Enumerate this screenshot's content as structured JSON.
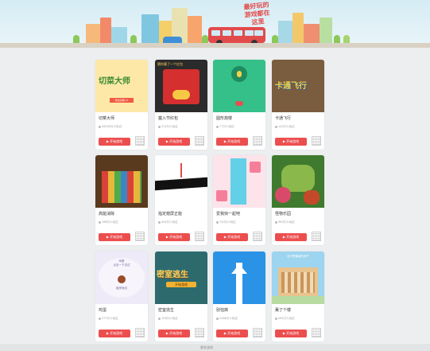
{
  "banner": {
    "slogan": "最好玩的\n游戏都在\n这里"
  },
  "cards": [
    {
      "title": "切菜大师",
      "plays": "28200万人玩过",
      "start": "开始游戏",
      "thumb_text": "切菜大师",
      "thumb_sub": "攻击次数+5"
    },
    {
      "title": "塞入节红包",
      "plays": "312万人玩过",
      "start": "开始游戏",
      "thumb_text": "猜你塞了一个红包"
    },
    {
      "title": "圆形炮楼",
      "plays": "77万人玩过",
      "start": "开始游戏",
      "thumb_text": ""
    },
    {
      "title": "卡通飞行",
      "plays": "142万人玩过",
      "start": "开始游戏",
      "thumb_text": "卡通飞行"
    },
    {
      "title": "高能消除",
      "plays": "168万人玩过",
      "start": "开始游戏",
      "thumb_text": ""
    },
    {
      "title": "指定窥屏正能",
      "plays": "404万人玩过",
      "start": "开始游戏",
      "thumb_text": ""
    },
    {
      "title": "爱我快一起吧",
      "plays": "743万人玩过",
      "start": "开始游戏",
      "thumb_text": ""
    },
    {
      "title": "怪物乐园",
      "plays": "363万人玩过",
      "start": "开始游戏",
      "thumb_text": ""
    },
    {
      "title": "鸡蛋",
      "plays": "377万人玩过",
      "start": "开始游戏",
      "thumb_text": "鸡蛋\n点击一下试试",
      "thumb_sub": "破壳而出"
    },
    {
      "title": "密室逃生",
      "plays": "128万人玩过",
      "start": "开始游戏",
      "thumb_text": "密室逃生",
      "thumb_sub": "开始游戏"
    },
    {
      "title": "别怕抹",
      "plays": "2066万人玩过",
      "start": "开始游戏",
      "thumb_text": ""
    },
    {
      "title": "薰了个楼",
      "plays": "261万人玩过",
      "start": "开始游戏",
      "thumb_text": "这才是最高的房子"
    }
  ],
  "footer": {
    "text": "更多游戏"
  },
  "colors": {
    "accent": "#ec4e4e",
    "background": "#eceef0"
  }
}
